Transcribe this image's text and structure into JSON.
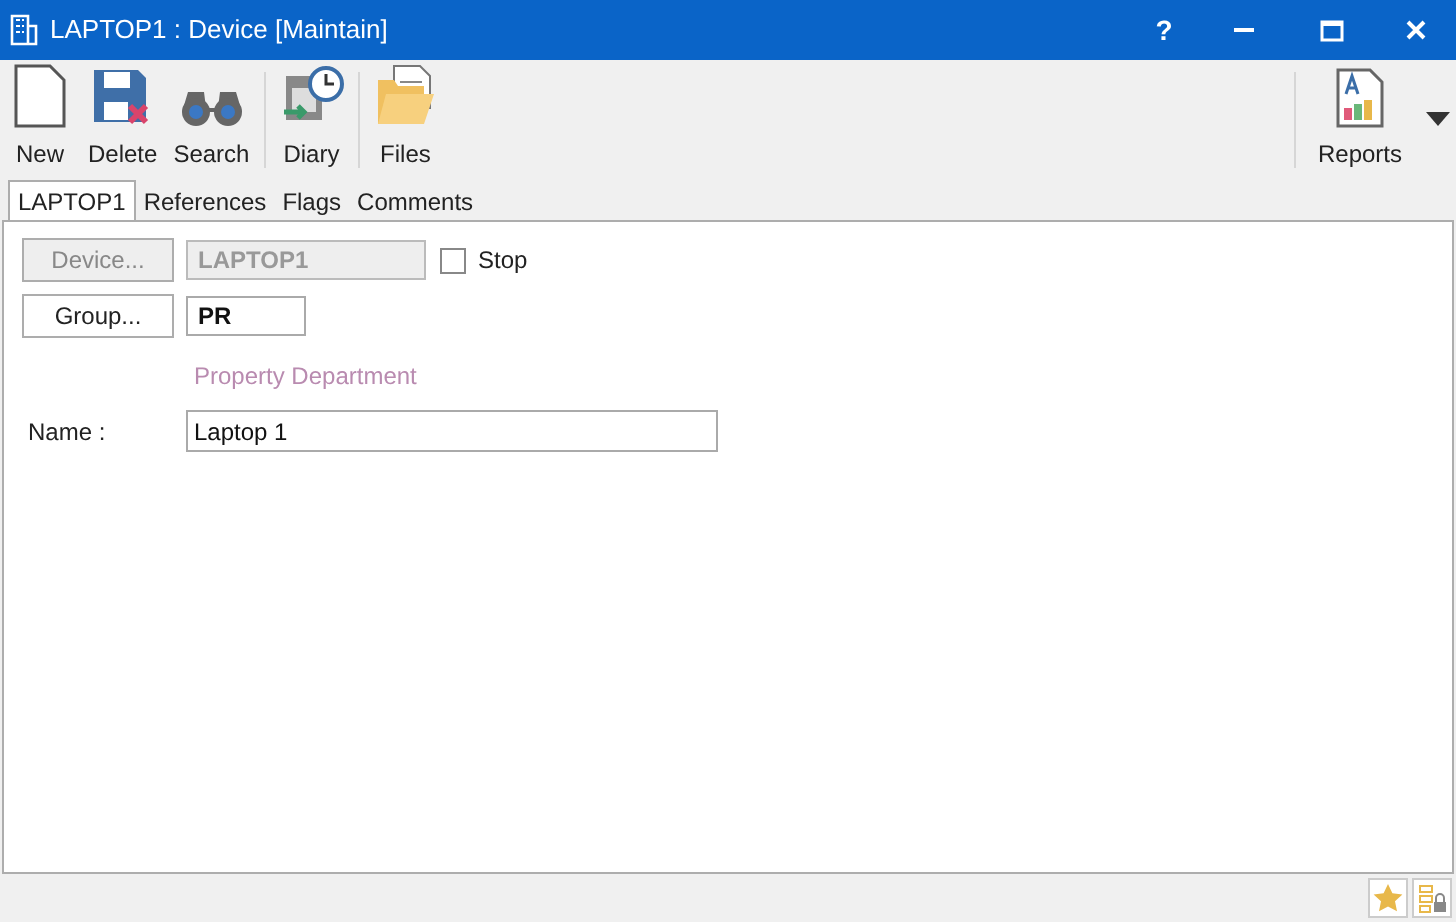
{
  "window": {
    "title": "LAPTOP1 : Device [Maintain]",
    "controls": [
      "?"
    ]
  },
  "toolbar": [
    {
      "label": "New"
    },
    {
      "label": "Delete"
    },
    {
      "label": "Search"
    },
    {
      "label": "Diary"
    },
    {
      "label": "Files"
    }
  ],
  "reports": {
    "label": "Reports"
  },
  "tabs": [
    {
      "label": "LAPTOP1",
      "selected": true
    },
    {
      "label": "References",
      "selected": false
    },
    {
      "label": "Flags",
      "selected": false
    },
    {
      "label": "Comments",
      "selected": false
    }
  ],
  "form": {
    "device_button": {
      "label": "Device...",
      "disabled": true
    },
    "device_field": {
      "value": "LAPTOP1",
      "disabled": true
    },
    "stop": {
      "label": "Stop",
      "checked": false
    },
    "group_button": {
      "label": "Group...",
      "disabled": false
    },
    "group_field": {
      "value": "PR"
    },
    "group_description": "Property Department",
    "name_label": "Name :",
    "name_field": {
      "value": "Laptop 1"
    }
  }
}
